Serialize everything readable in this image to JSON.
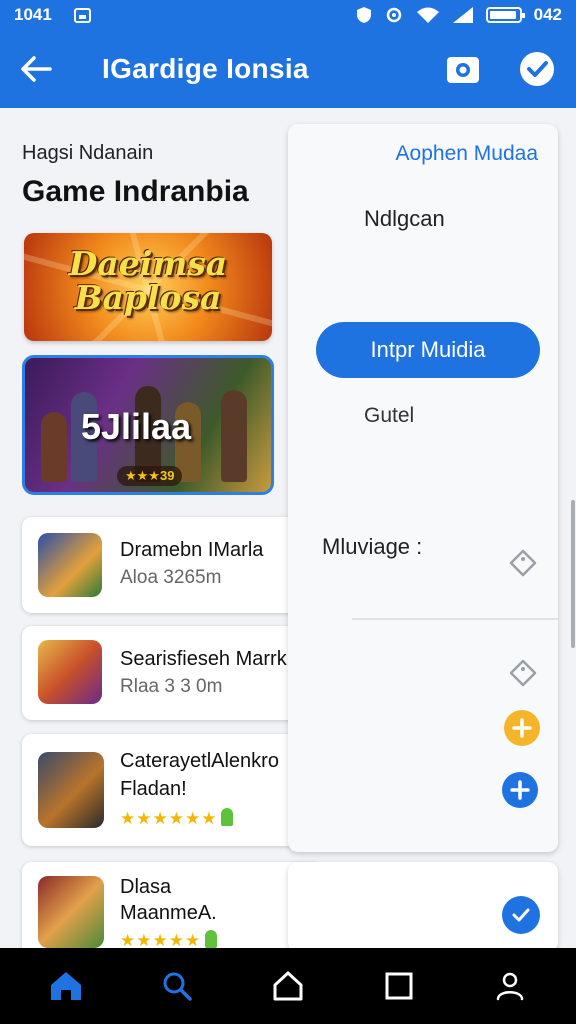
{
  "status_bar": {
    "time": "1041",
    "right_time": "042"
  },
  "app_bar": {
    "title": "IGardige Ionsia"
  },
  "subtitle": "Hagsi Ndanain",
  "heading": "Game Indranbia",
  "banners": [
    {
      "title_line1": "Daeimsa",
      "title_line2": "Baplosa"
    },
    {
      "title": "5Jlilaa",
      "badge": "★★★39"
    }
  ],
  "list": [
    {
      "name": "Dramebn IMarla",
      "meta": "Aloa 3265m"
    },
    {
      "name": "Searisfieseh Marrk",
      "meta": "Rlaa 3 3 0m"
    },
    {
      "name": "CaterayetlAlenkro",
      "name2": "Fladan!",
      "rating": "★★★★★★"
    },
    {
      "name": "Dlasa",
      "name2": "MaanmeA.",
      "rating": "★★★★★"
    }
  ],
  "panel": {
    "link": "Aophen Mudaa",
    "option1": "Ndlgcan",
    "primary_button": "Intpr Muidia",
    "option2": "Gutel",
    "label": "Mluviage :"
  },
  "colors": {
    "primary": "#1f73e0",
    "accent": "#f4b52a"
  }
}
